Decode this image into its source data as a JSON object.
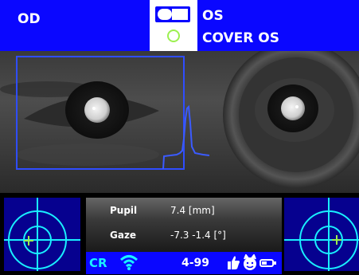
{
  "header": {
    "left_eye_label": "OD",
    "right_eye_label": "OS",
    "cover_label": "COVER OS",
    "toggle_icon": "eye-toggle-icon",
    "cover_icon": "cover-ring-icon"
  },
  "readout": {
    "pupil_label": "Pupil",
    "pupil_value": "7.4 [mm]",
    "gaze_label": "Gaze",
    "gaze_value": "-7.3  -1.4 [°]"
  },
  "status": {
    "mode": "CR",
    "counter": "4-99",
    "icons": [
      "wifi-icon",
      "thumbs-up-icon",
      "face-icon",
      "battery-icon"
    ]
  },
  "colors": {
    "header_blue": "#0a07ff",
    "target_blue": "#06018f",
    "crosshair_cyan": "#19f0ff",
    "marker_green": "#9cf050",
    "trace_blue": "#3b5bff"
  }
}
